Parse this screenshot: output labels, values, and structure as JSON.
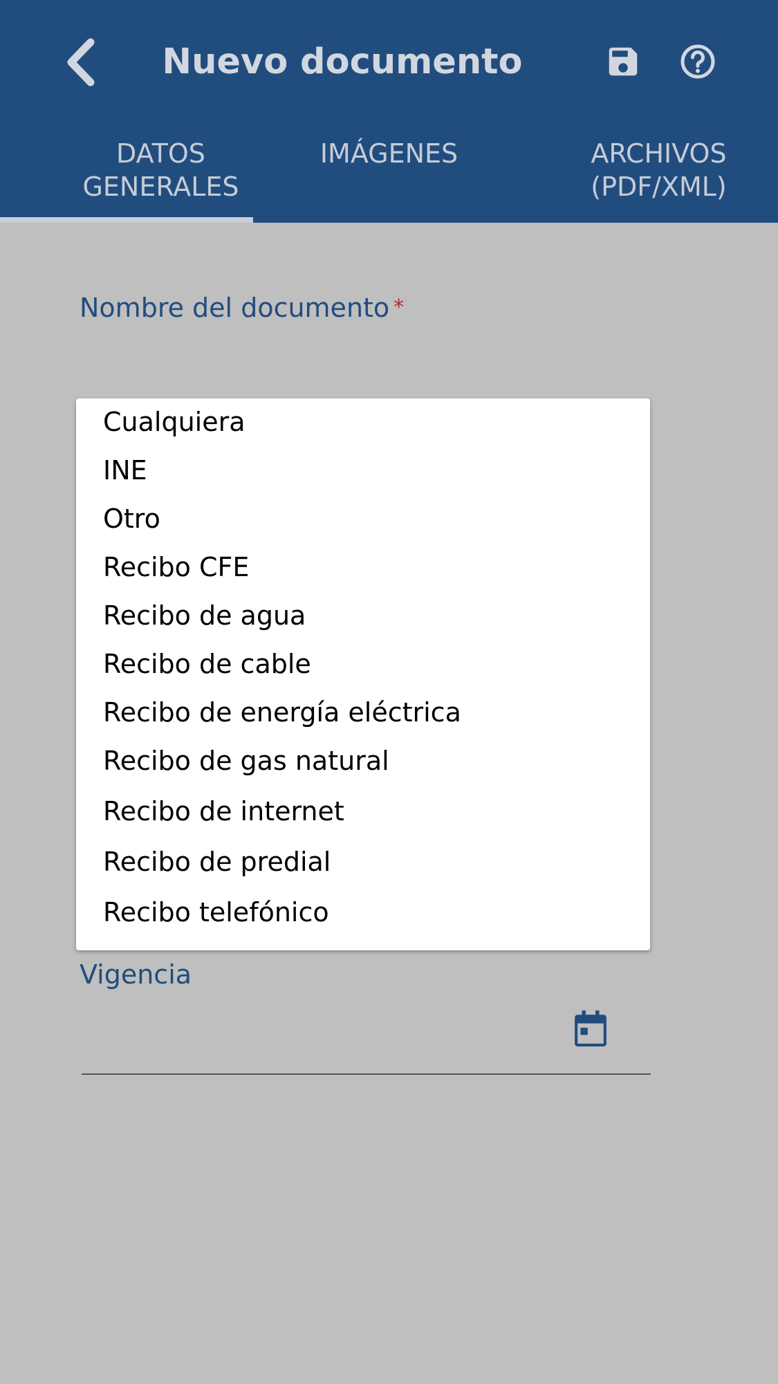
{
  "header": {
    "title": "Nuevo documento",
    "back_icon": "chevron-left-icon",
    "save_icon": "floppy-disk-icon",
    "help_icon": "help-circle-icon"
  },
  "tabs": [
    {
      "line1": "DATOS",
      "line2": "GENERALES",
      "active": true
    },
    {
      "line1": "IMÁGENES",
      "line2": "",
      "active": false
    },
    {
      "line1": "ARCHIVOS",
      "line2": "(PDF/XML)",
      "active": false
    }
  ],
  "form": {
    "document_name_label": "Nombre del documento",
    "required_mark": "*",
    "expiry_label": "Vigencia",
    "calendar_icon": "calendar-icon"
  },
  "dropdown": {
    "options": [
      "Cualquiera",
      "INE",
      "Otro",
      "Recibo CFE",
      "Recibo de agua",
      "Recibo de cable",
      "Recibo de energía eléctrica",
      "Recibo de gas natural",
      "Recibo de internet",
      "Recibo de predial",
      "Recibo telefónico"
    ]
  },
  "colors": {
    "primary": "#214c7e",
    "background": "#bfbfbf",
    "required": "#b12b2b",
    "tab_text": "#c5ccd7"
  }
}
